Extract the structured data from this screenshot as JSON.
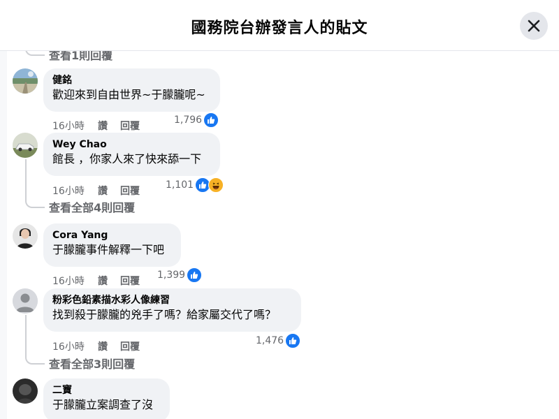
{
  "header": {
    "title": "國務院台辦發言人的貼文"
  },
  "top_reply_link": "查看1則回覆",
  "comments": [
    {
      "author": "健銘",
      "text": "歡迎來到自由世界~于朦朧呢~",
      "time": "16小時",
      "like_label": "讚",
      "reply_label": "回覆",
      "reaction_count": "1,796",
      "reactions": [
        "like-icon"
      ],
      "avatar": "landscape-avatar"
    },
    {
      "author": "Wey Chao",
      "text": "館長 ，你家人來了快來舔一下",
      "time": "16小時",
      "like_label": "讚",
      "reply_label": "回覆",
      "reaction_count": "1,101",
      "reactions": [
        "like-icon",
        "haha-icon"
      ],
      "avatar": "car-avatar",
      "replies_link": "查看全部4則回覆"
    },
    {
      "author": "Cora Yang",
      "text": "于朦朧事件解釋一下吧",
      "time": "16小時",
      "like_label": "讚",
      "reply_label": "回覆",
      "reaction_count": "1,399",
      "reactions": [
        "like-icon"
      ],
      "avatar": "portrait-avatar"
    },
    {
      "author": "粉彩色鉛素描水彩人像練習",
      "text": "找到殺于朦朧的兇手了嗎？給家屬交代了嗎？",
      "time": "16小時",
      "like_label": "讚",
      "reply_label": "回覆",
      "reaction_count": "1,476",
      "reactions": [
        "like-icon"
      ],
      "avatar": "default-avatar",
      "replies_link": "查看全部3則回覆"
    },
    {
      "author": "二寶",
      "text": "于朦朧立案調查了沒",
      "avatar": "dark-avatar"
    }
  ],
  "colors": {
    "like": "#1877f2",
    "bubble": "#f0f2f5",
    "meta": "#65676b",
    "haha": "#f7b125"
  }
}
